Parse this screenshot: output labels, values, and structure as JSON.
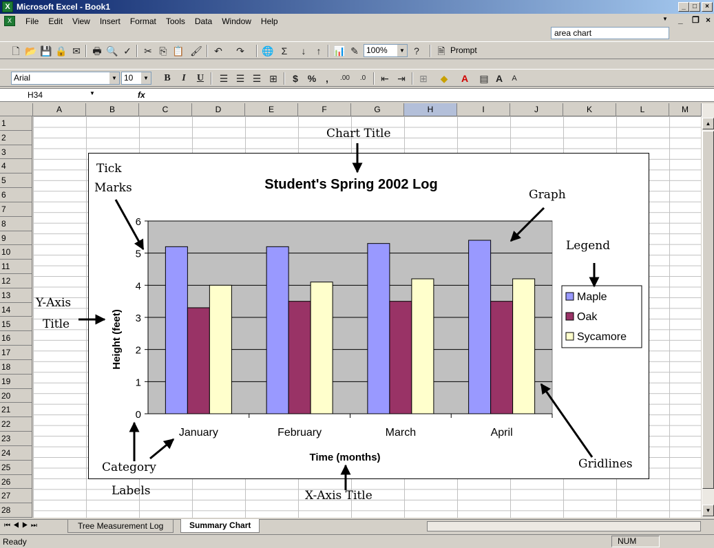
{
  "window": {
    "title": "Microsoft Excel - Book1",
    "min": "_",
    "max": "□",
    "close": "×",
    "app_icon": "X"
  },
  "menu": {
    "items": [
      "File",
      "Edit",
      "View",
      "Insert",
      "Format",
      "Tools",
      "Data",
      "Window",
      "Help"
    ],
    "ask_box": "area chart",
    "doc_min": "_",
    "doc_restore": "❐",
    "doc_close": "×"
  },
  "toolbar": {
    "zoom": "100%",
    "prompt": "Prompt",
    "font": "Arial",
    "size": "10",
    "bold": "B",
    "italic": "I",
    "underline": "U",
    "currency": "$",
    "percent": "%",
    "comma": ",",
    "inc_dec": ".00",
    "dec_dec": ".0"
  },
  "formula": {
    "cell": "H34",
    "fx": "fx",
    "value": ""
  },
  "columns": [
    "A",
    "B",
    "C",
    "D",
    "E",
    "F",
    "G",
    "H",
    "I",
    "J",
    "K",
    "L",
    "M"
  ],
  "selected_column": "H",
  "rows": [
    "1",
    "2",
    "3",
    "4",
    "5",
    "6",
    "7",
    "8",
    "9",
    "10",
    "11",
    "12",
    "13",
    "14",
    "15",
    "16",
    "17",
    "18",
    "19",
    "20",
    "21",
    "22",
    "23",
    "24",
    "25",
    "26",
    "27",
    "28"
  ],
  "chart_data": {
    "type": "bar",
    "title": "Student's Spring 2002 Log",
    "xlabel": "Time (months)",
    "ylabel": "Height (feet)",
    "categories": [
      "January",
      "February",
      "March",
      "April"
    ],
    "series": [
      {
        "name": "Maple",
        "values": [
          5.2,
          5.2,
          5.3,
          5.4
        ],
        "color": "#9999ff"
      },
      {
        "name": "Oak",
        "values": [
          3.3,
          3.5,
          3.5,
          3.5
        ],
        "color": "#993366"
      },
      {
        "name": "Sycamore",
        "values": [
          4.0,
          4.1,
          4.2,
          4.2
        ],
        "color": "#ffffcc"
      }
    ],
    "ylim": [
      0,
      6
    ],
    "yticks": [
      "0",
      "1",
      "2",
      "3",
      "4",
      "5",
      "6"
    ],
    "grid": true,
    "plot_bg": "#c0c0c0",
    "legend": "right"
  },
  "annotations": {
    "chart_title": "Chart Title",
    "tick_marks_1": "Tick",
    "tick_marks_2": "Marks",
    "graph": "Graph",
    "legend": "Legend",
    "y_axis_1": "Y-Axis",
    "y_axis_2": "Title",
    "category_1": "Category",
    "category_2": "Labels",
    "x_axis": "X-Axis Title",
    "gridlines": "Gridlines"
  },
  "sheets": {
    "tabs": [
      "Tree Measurement Log",
      "Summary Chart"
    ],
    "active": "Summary Chart"
  },
  "status": {
    "left": "Ready",
    "num": "NUM"
  }
}
